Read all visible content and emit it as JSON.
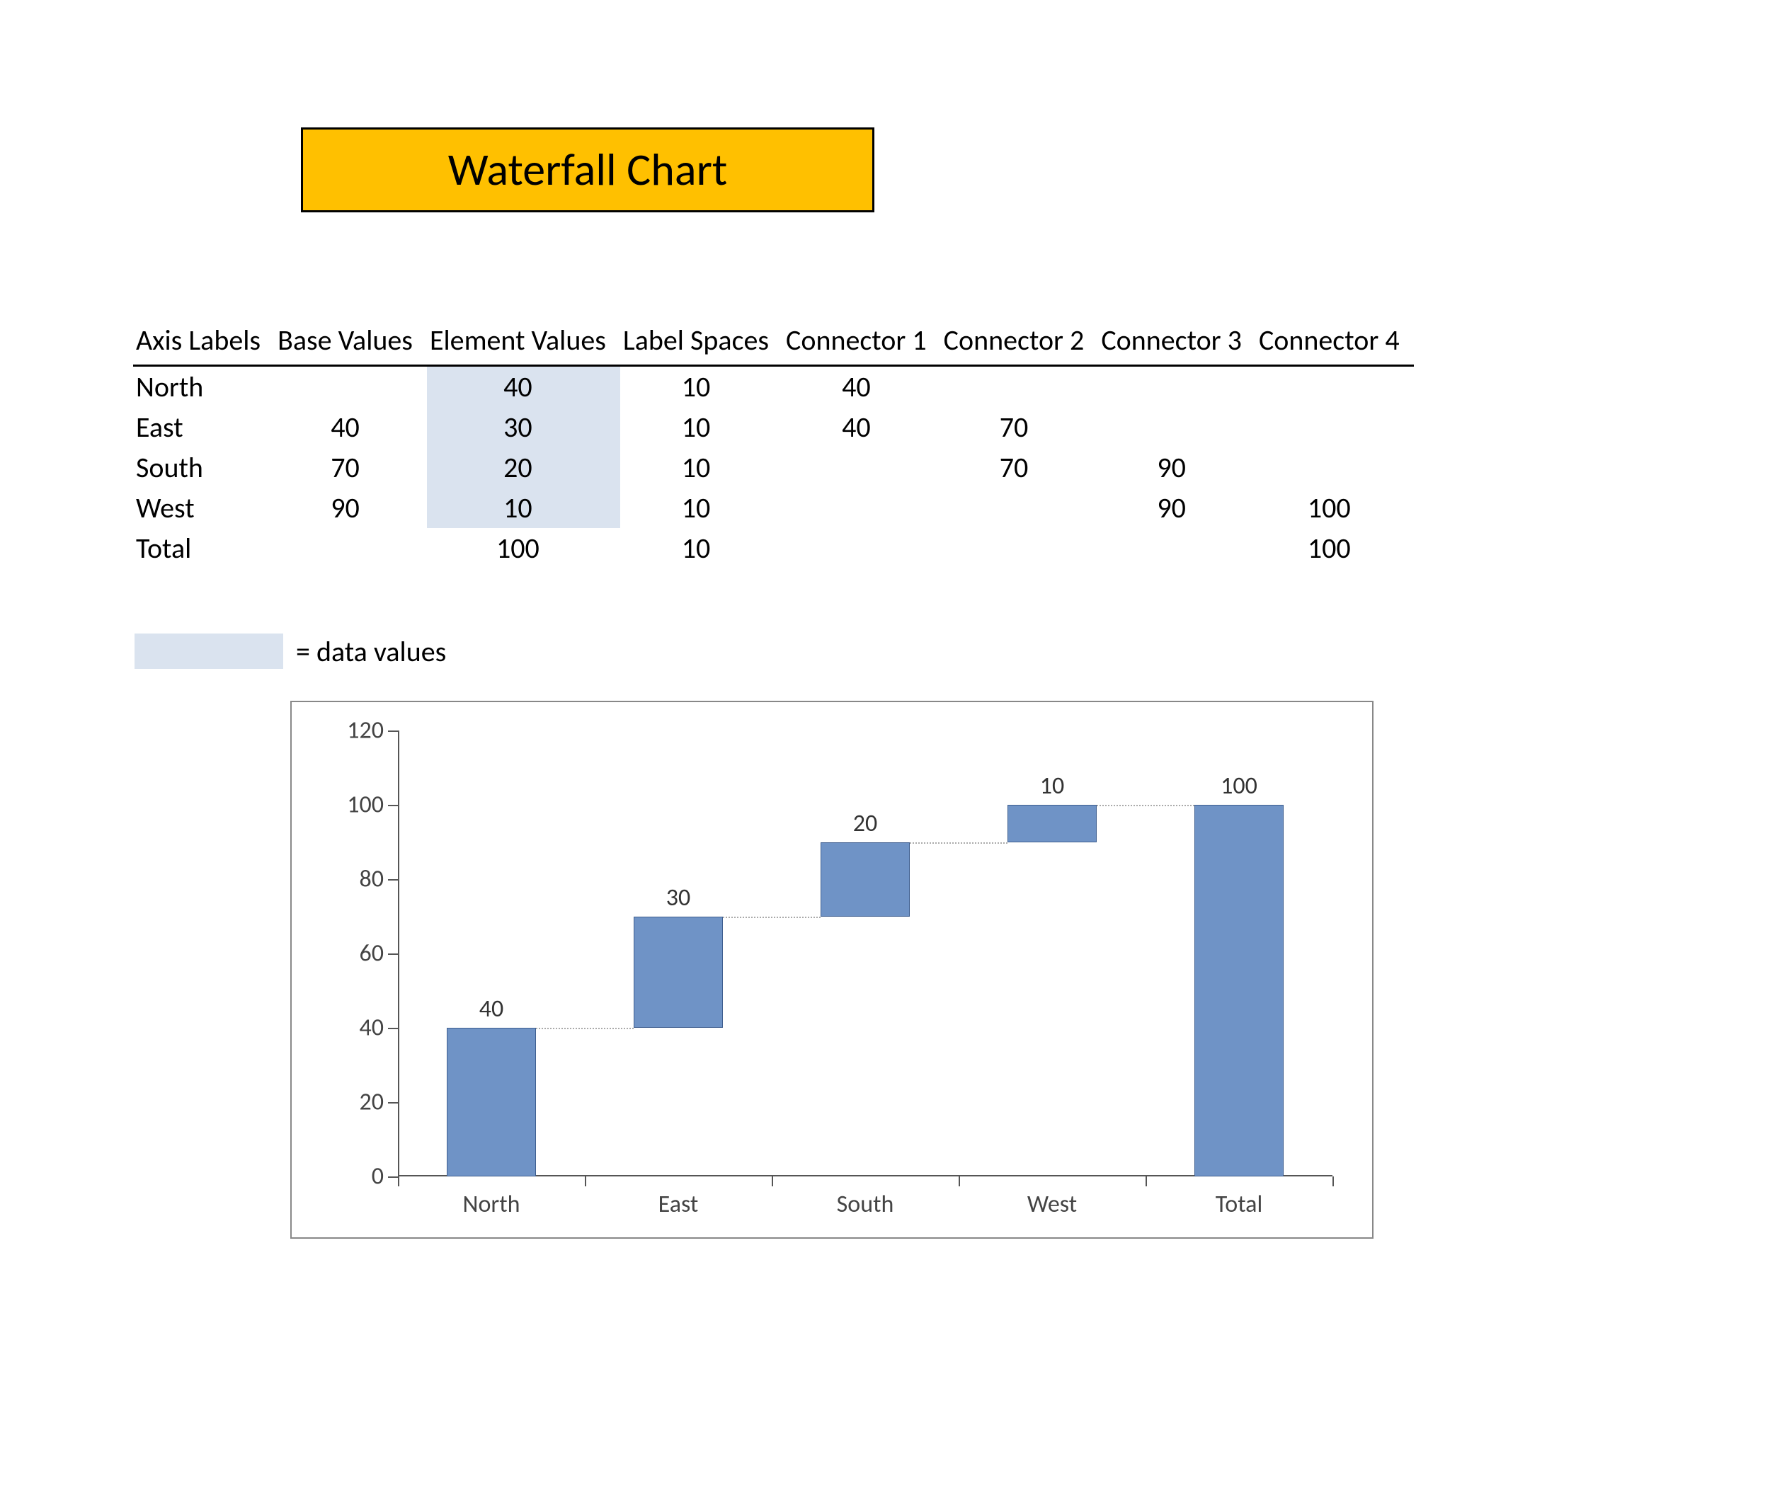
{
  "title": "Waterfall Chart",
  "table": {
    "headers": [
      "Axis Labels",
      "Base Values",
      "Element Values",
      "Label Spaces",
      "Connector 1",
      "Connector 2",
      "Connector 3",
      "Connector 4"
    ],
    "rows": [
      {
        "label": "North",
        "base": "",
        "element": "40",
        "labelspace": "10",
        "c1": "40",
        "c2": "",
        "c3": "",
        "c4": "",
        "hl": true
      },
      {
        "label": "East",
        "base": "40",
        "element": "30",
        "labelspace": "10",
        "c1": "40",
        "c2": "70",
        "c3": "",
        "c4": "",
        "hl": true
      },
      {
        "label": "South",
        "base": "70",
        "element": "20",
        "labelspace": "10",
        "c1": "",
        "c2": "70",
        "c3": "90",
        "c4": "",
        "hl": true
      },
      {
        "label": "West",
        "base": "90",
        "element": "10",
        "labelspace": "10",
        "c1": "",
        "c2": "",
        "c3": "90",
        "c4": "100",
        "hl": true
      },
      {
        "label": "Total",
        "base": "",
        "element": "100",
        "labelspace": "10",
        "c1": "",
        "c2": "",
        "c3": "",
        "c4": "100",
        "hl": false
      }
    ]
  },
  "legend_text": "= data values",
  "chart_data": {
    "type": "bar",
    "title": "",
    "xlabel": "",
    "ylabel": "",
    "ylim": [
      0,
      120
    ],
    "yticks": [
      0,
      20,
      40,
      60,
      80,
      100,
      120
    ],
    "categories": [
      "North",
      "East",
      "South",
      "West",
      "Total"
    ],
    "series": [
      {
        "name": "Base",
        "role": "invisible",
        "values": [
          0,
          40,
          70,
          90,
          0
        ]
      },
      {
        "name": "Element",
        "role": "visible",
        "values": [
          40,
          30,
          20,
          10,
          100
        ]
      }
    ],
    "data_labels": [
      40,
      30,
      20,
      10,
      100
    ],
    "connectors": [
      {
        "from_cat": "North",
        "to_cat": "East",
        "y": 40
      },
      {
        "from_cat": "East",
        "to_cat": "South",
        "y": 70
      },
      {
        "from_cat": "South",
        "to_cat": "West",
        "y": 90
      },
      {
        "from_cat": "West",
        "to_cat": "Total",
        "y": 100
      }
    ],
    "bar_color": "#6F93C6",
    "bar_border": "#3E5E8F"
  }
}
